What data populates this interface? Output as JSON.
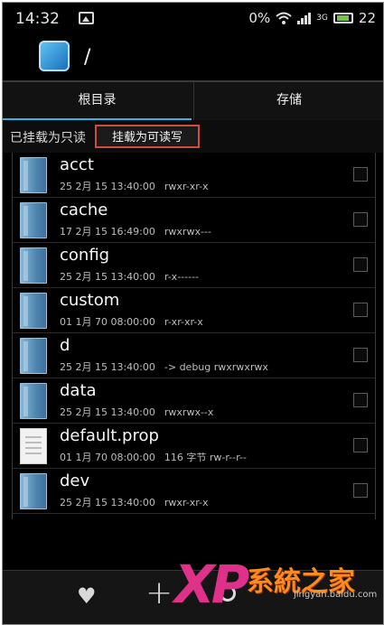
{
  "status_bar": {
    "time": "14:32",
    "battery_percent": "0%",
    "network": "3G",
    "battery_level": "22"
  },
  "header": {
    "path": "/"
  },
  "tabs": [
    {
      "label": "根目录",
      "active": true
    },
    {
      "label": "存储",
      "active": false
    }
  ],
  "mount": {
    "status": "已挂载为只读",
    "button": "挂载为可读写"
  },
  "files": [
    {
      "name": "acct",
      "date": "25 2月 15 13:40:00",
      "perm": "rwxr-xr-x",
      "type": "folder"
    },
    {
      "name": "cache",
      "date": "17 2月 15 16:49:00",
      "perm": "rwxrwx---",
      "type": "folder"
    },
    {
      "name": "config",
      "date": "25 2月 15 13:40:00",
      "perm": "r-x------",
      "type": "folder"
    },
    {
      "name": "custom",
      "date": "01 1月 70 08:00:00",
      "perm": "r-xr-xr-x",
      "type": "folder"
    },
    {
      "name": "d",
      "date": "25 2月 15 13:40:00",
      "perm": "-> debug  rwxrwxrwx",
      "type": "folder"
    },
    {
      "name": "data",
      "date": "25 2月 15 13:40:00",
      "perm": "rwxrwx--x",
      "type": "folder"
    },
    {
      "name": "default.prop",
      "date": "01 1月 70 08:00:00",
      "perm": "116 字节  rw-r--r--",
      "type": "file"
    },
    {
      "name": "dev",
      "date": "25 2月 15 13:40:00",
      "perm": "rwxr-xr-x",
      "type": "folder"
    }
  ],
  "watermark": {
    "brand": "XP",
    "title": "系統之家",
    "site": "jingyan.baidu.com"
  },
  "colors": {
    "accent": "#33b5e5",
    "highlight_border": "#d44a3d",
    "watermark_pink": "#e0318a",
    "watermark_orange": "#ff8a1c"
  }
}
